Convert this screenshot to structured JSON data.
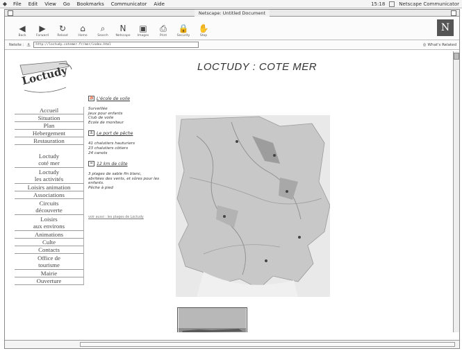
{
  "menubar": {
    "items": [
      "File",
      "Edit",
      "View",
      "Go",
      "Bookmarks",
      "Communicator",
      "Aide"
    ],
    "clock": "15:18",
    "app_name": "Netscape Communicator"
  },
  "window": {
    "title": "Netscape: Untitled Document"
  },
  "toolbar": {
    "buttons": [
      {
        "label": "Back",
        "icon": "◀"
      },
      {
        "label": "Forward",
        "icon": "▶"
      },
      {
        "label": "Reload",
        "icon": "↻"
      },
      {
        "label": "Home",
        "icon": "⌂"
      },
      {
        "label": "Search",
        "icon": "⌕"
      },
      {
        "label": "Netscape",
        "icon": "N"
      },
      {
        "label": "Images",
        "icon": "▣"
      },
      {
        "label": "Print",
        "icon": "⎙"
      },
      {
        "label": "Security",
        "icon": "🔒"
      },
      {
        "label": "Stop",
        "icon": "✋"
      }
    ]
  },
  "location": {
    "label": "Netsite :",
    "url": "http://loctudy.cotemer.fr/mer/index.html",
    "related_label": "What's Related"
  },
  "page": {
    "title": "LOCTUDY : COTE MER",
    "logo_text": "Loctudy",
    "nav": [
      {
        "label": "Accueil"
      },
      {
        "label": "Situation"
      },
      {
        "label": "Plan"
      },
      {
        "label": "Hebergement"
      },
      {
        "label": "Restauration"
      },
      {
        "label": "Loctudy\ncoté mer"
      },
      {
        "label": "Loctudy\nles activités"
      },
      {
        "label": "Loisirs animation"
      },
      {
        "label": "Associations"
      },
      {
        "label": "Circuits\ndécouverte"
      },
      {
        "label": "Loisirs\naux environs"
      },
      {
        "label": "Animations"
      },
      {
        "label": "Culte"
      },
      {
        "label": "Contacts"
      },
      {
        "label": "Office de\ntourisme"
      },
      {
        "label": "Mairie"
      },
      {
        "label": "Ouverture"
      }
    ],
    "sections": [
      {
        "heading": "L'école de voile",
        "lines": [
          "Surveillée",
          "Jeux pour enfants",
          "Club de voile",
          "Ecole de moniteur"
        ]
      },
      {
        "heading": "Le port de pêche",
        "lines": [
          "41 chalutiers hauturiers",
          "23 chalutiers côtiers",
          "24 canots"
        ]
      },
      {
        "heading": "12 km de côte",
        "lines": [
          "3 plages de sable fin blanc,",
          "abritées des vents, et sûres pour les",
          "enfants.",
          "Pêche à pied"
        ]
      }
    ],
    "footer_link": "voir aussi : les plages de Loctudy"
  }
}
